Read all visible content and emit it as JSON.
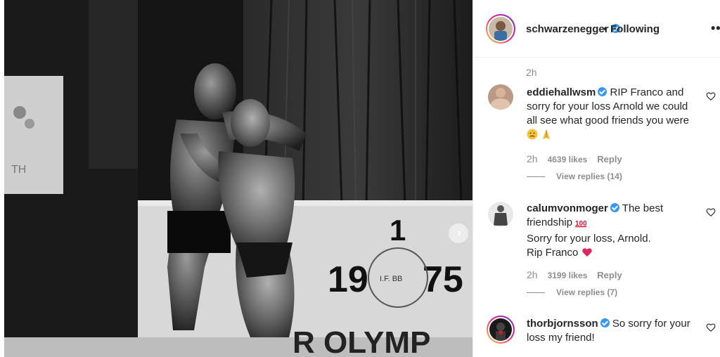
{
  "post": {
    "photo": {
      "stage_number": "1",
      "year_left": "19",
      "year_right": "75",
      "logo_text": "I.F. BB",
      "banner_text": "R OLYMP",
      "sign_text": "TH"
    },
    "next_icon": "chevron-right-icon"
  },
  "header": {
    "username": "schwarzenegger",
    "dot": "•",
    "follow_label": "Following",
    "more_label": "•••"
  },
  "caption_time": "2h",
  "comments": [
    {
      "username": "eddiehallwsm",
      "text": "RIP Franco and sorry for your loss Arnold we could all see what good friends you were",
      "time": "2h",
      "likes": "4639 likes",
      "reply": "Reply",
      "view_replies": "View replies (14)"
    },
    {
      "username": "calumvonmoger",
      "text_1": "The best friendship",
      "text_2": "Sorry for your loss, Arnold.",
      "text_3": "Rip Franco",
      "time": "2h",
      "likes": "3199 likes",
      "reply": "Reply",
      "view_replies": "View replies (7)"
    },
    {
      "username": "thorbjornsson",
      "text": "So sorry for your loss my friend!"
    }
  ],
  "colors": {
    "verified": "#3897f0",
    "muted": "#8e8e8e",
    "text": "#262626",
    "heart_emoji": "#e0245e"
  }
}
